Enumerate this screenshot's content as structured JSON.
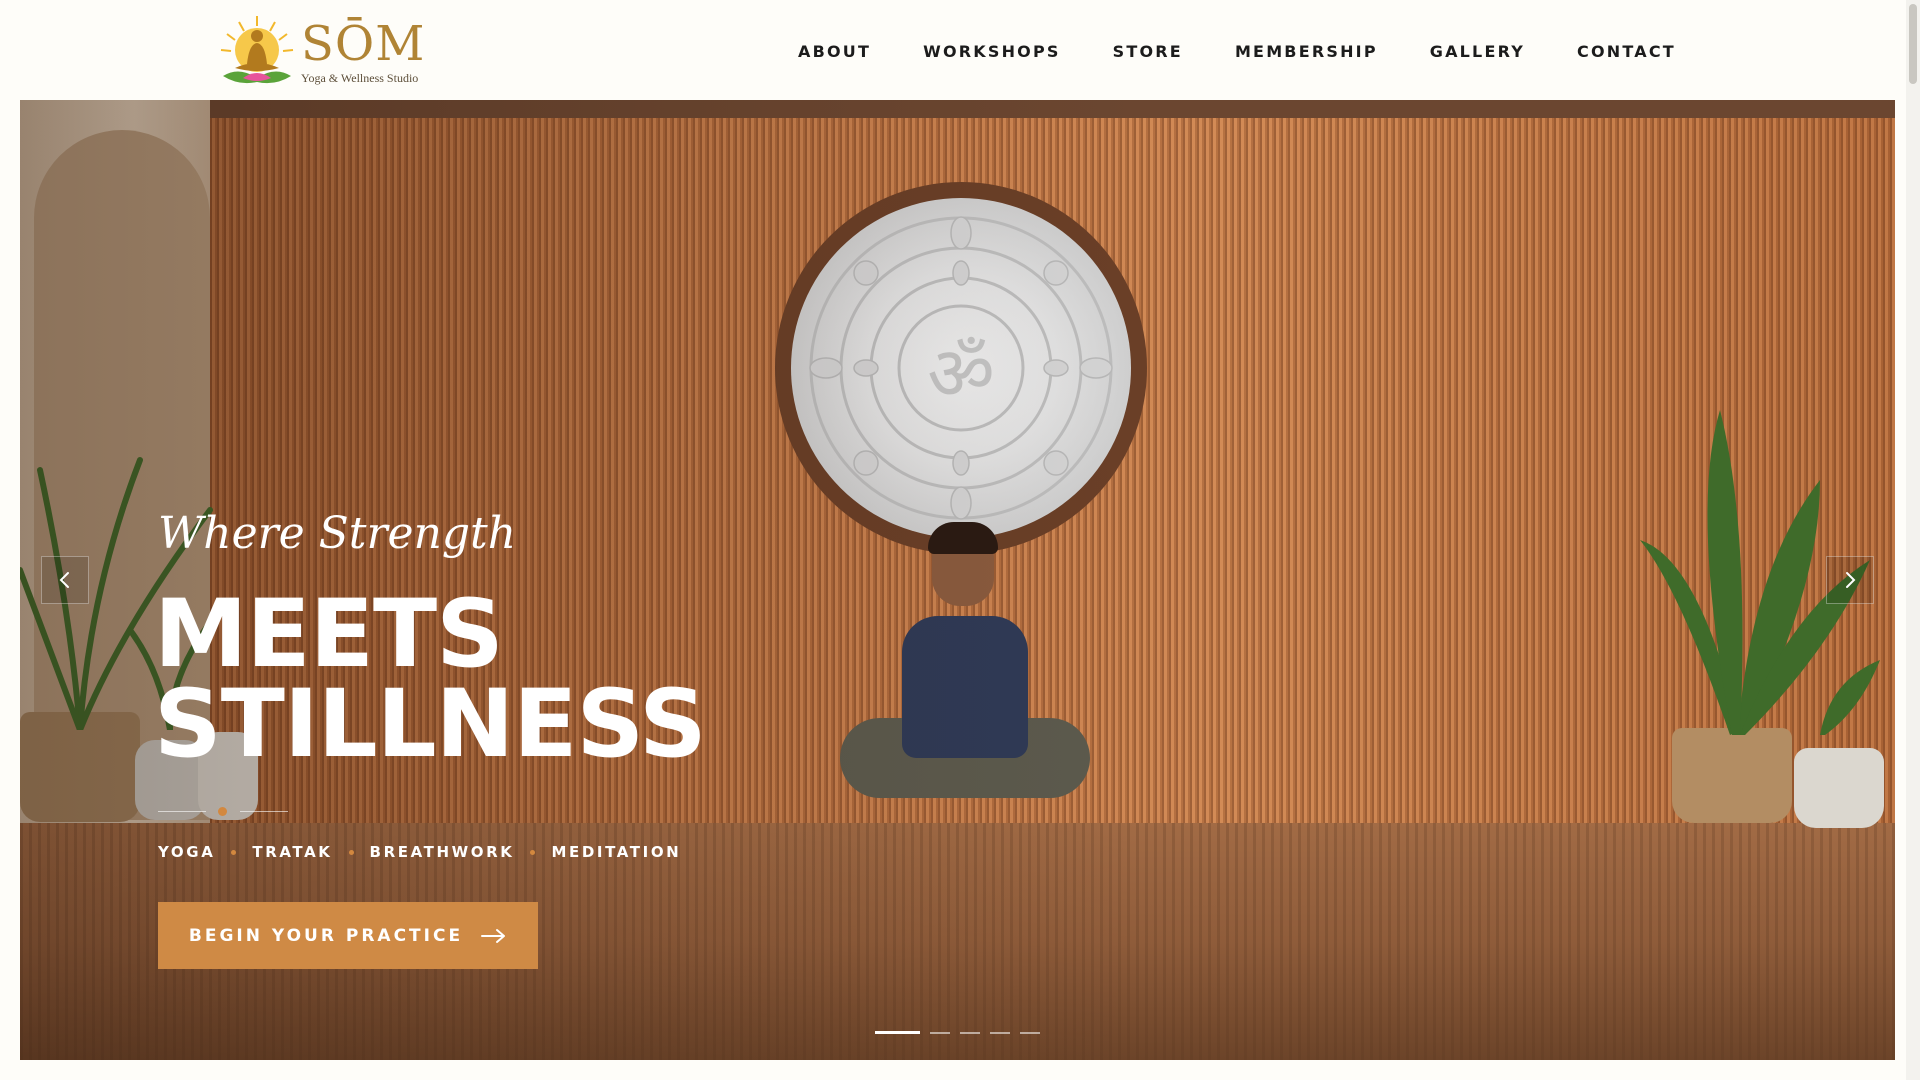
{
  "logo": {
    "name": "SŌM",
    "tagline": "Yoga & Wellness Studio",
    "icon": "meditating-figure-sun-lotus-icon"
  },
  "nav": {
    "items": [
      "ABOUT",
      "WORKSHOPS",
      "STORE",
      "MEMBERSHIP",
      "GALLERY",
      "CONTACT"
    ]
  },
  "hero": {
    "script_text": "Where Strength",
    "headline_line1": "MEETS",
    "headline_line2": "STILLNESS",
    "tags": [
      "YOGA",
      "TRATAK",
      "BREATHWORK",
      "MEDITATION"
    ],
    "cta_label": "BEGIN YOUR PRACTICE",
    "cta_icon": "arrow-right-icon",
    "prev_icon": "chevron-left-icon",
    "next_icon": "chevron-right-icon",
    "slides": {
      "count": 5,
      "active_index": 0
    }
  },
  "colors": {
    "accent": "#cf8a45",
    "logo_gold": "#b08435",
    "nav_text": "#1c1c1c",
    "page_bg": "#fefdf9"
  }
}
